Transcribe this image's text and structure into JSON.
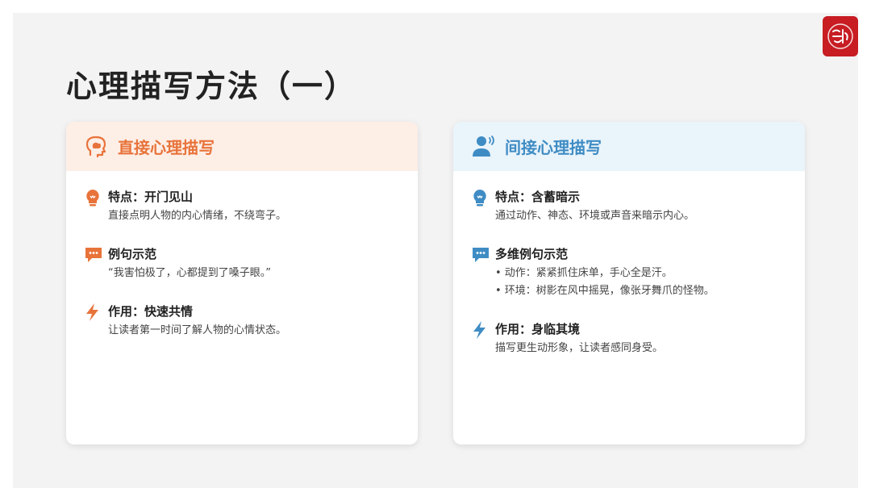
{
  "slide": {
    "title": "心理描写方法（一）"
  },
  "left_card": {
    "title": "直接心理描写",
    "accent": "#e8733a",
    "items": [
      {
        "icon": "lightbulb-icon",
        "title": "特点：开门见山",
        "text": "直接点明人物的内心情绪，不绕弯子。"
      },
      {
        "icon": "speech-bubble-icon",
        "title": "例句示范",
        "text": "“我害怕极了，心都提到了嗓子眼。”"
      },
      {
        "icon": "lightning-icon",
        "title": "作用：快速共情",
        "text": "让读者第一时间了解人物的心情状态。"
      }
    ]
  },
  "right_card": {
    "title": "间接心理描写",
    "accent": "#3f8cc4",
    "items": [
      {
        "icon": "lightbulb-icon",
        "title": "特点：含蓄暗示",
        "text": "通过动作、神态、环境或声音来暗示内心。"
      },
      {
        "icon": "speech-bubble-icon",
        "title": "多维例句示范",
        "bullets": [
          "• 动作：紧紧抓住床单，手心全是汗。",
          "• 环境：树影在风中摇晃，像张牙舞爪的怪物。"
        ]
      },
      {
        "icon": "lightning-icon",
        "title": "作用：身临其境",
        "text": "描写更生动形象，让读者感同身受。"
      }
    ]
  }
}
